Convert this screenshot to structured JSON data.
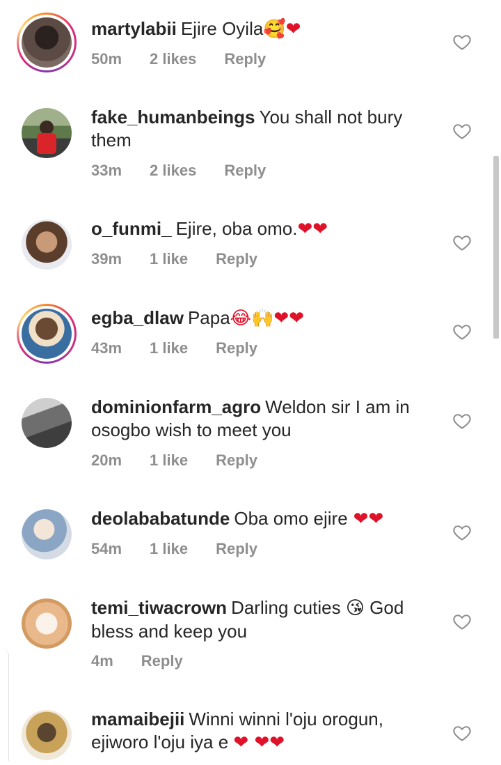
{
  "comments": [
    {
      "username": "martylabii",
      "text": "Ejire Oyila",
      "emoji": "🥰❤",
      "time": "50m",
      "likes": "2 likes",
      "reply": "Reply",
      "story": true,
      "avatar_bg": "#4a3a36"
    },
    {
      "username": "fake_humanbeings",
      "text": "You shall not bury them",
      "emoji": "",
      "time": "33m",
      "likes": "2 likes",
      "reply": "Reply",
      "story": false,
      "avatar_bg": "#6f8a5a"
    },
    {
      "username": "o_funmi_",
      "text": "Ejire, oba omo.",
      "emoji": "❤❤",
      "time": "39m",
      "likes": "1 like",
      "reply": "Reply",
      "story": false,
      "avatar_bg": "#b08c6a"
    },
    {
      "username": "egba_dlaw",
      "text": "Papa",
      "emoji": "😂🙌❤❤",
      "time": "43m",
      "likes": "1 like",
      "reply": "Reply",
      "story": true,
      "avatar_bg": "#3b5f8a"
    },
    {
      "username": "dominionfarm_agro",
      "text": "Weldon sir I am in osogbo wish to meet you",
      "emoji": "",
      "time": "20m",
      "likes": "1 like",
      "reply": "Reply",
      "story": false,
      "avatar_bg": "#7c7c7c"
    },
    {
      "username": "deolababatunde",
      "text": "Oba omo ejire",
      "emoji": "❤❤",
      "time": "54m",
      "likes": "1 like",
      "reply": "Reply",
      "story": false,
      "avatar_bg": "#9fb3c8"
    },
    {
      "username": "temi_tiwacrown",
      "text": "Darling cuties",
      "emoji": "😘",
      "text2": "God bless and keep you",
      "time": "4m",
      "likes": "",
      "reply": "Reply",
      "story": false,
      "avatar_bg": "#e8c9a4"
    },
    {
      "username": "mamaibejii",
      "text": "Winni winni l'oju orogun, ejiworo l'oju iya e",
      "emoji": "❤ ❤❤",
      "time": "",
      "likes": "",
      "reply": "",
      "story": false,
      "avatar_bg": "#7a6a4a"
    }
  ],
  "colors": {
    "heart": "#e0122a",
    "meta": "#8e8e8e",
    "text": "#262626"
  },
  "icons": {
    "like": "heart-outline-icon"
  }
}
